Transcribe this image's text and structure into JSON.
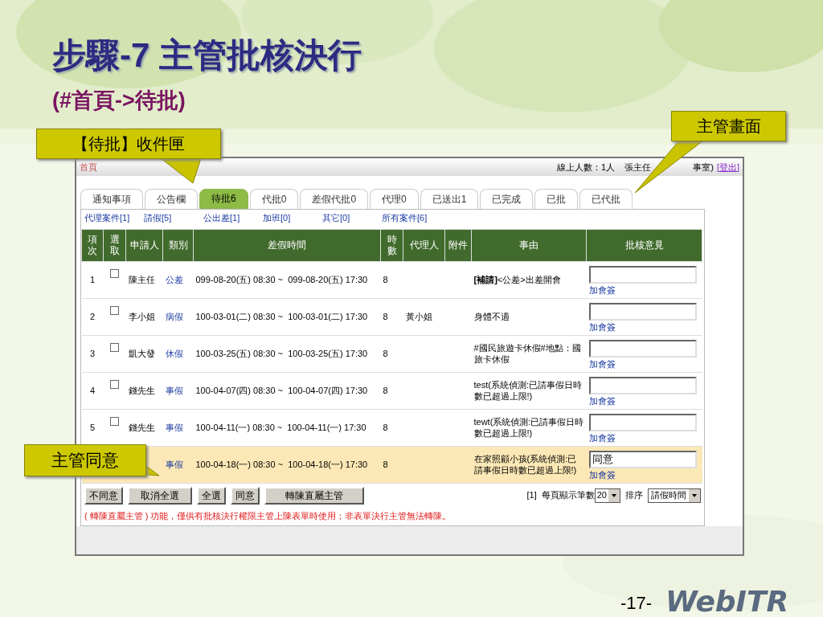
{
  "slide": {
    "title": "步驟-7  主管批核決行",
    "subtitle": "(#首頁->待批)",
    "page_number": "-17-",
    "logo": "WebITR",
    "callouts": [
      {
        "kind": "inbox",
        "text": "【待批】收件匣"
      },
      {
        "kind": "screen",
        "text": "主管畫面"
      },
      {
        "kind": "agree",
        "text": "主管同意"
      }
    ]
  },
  "app": {
    "breadcrumb": "首頁",
    "online": "線上人數：1人",
    "user_visible": [
      "張主任",
      "事室)"
    ],
    "logout": "[登出]",
    "tabs": [
      {
        "label": "通知事項",
        "selected": false
      },
      {
        "label": "公告欄",
        "selected": false
      },
      {
        "label": "待批6",
        "selected": true
      },
      {
        "label": "代批0",
        "selected": false
      },
      {
        "label": "差假代批0",
        "selected": false
      },
      {
        "label": "代理0",
        "selected": false
      },
      {
        "label": "已送出1",
        "selected": false
      },
      {
        "label": "已完成",
        "selected": false
      },
      {
        "label": "已批",
        "selected": false
      },
      {
        "label": "已代批",
        "selected": false
      }
    ],
    "filters": [
      "代理案件[1]",
      "請假[5]",
      "公出差[1]",
      "加班[0]",
      "其它[0]",
      "所有案件[6]"
    ],
    "columns": [
      "項次",
      "選取",
      "申請人",
      "類別",
      "差假時間",
      "時數",
      "代理人",
      "附件",
      "事由",
      "批核意見"
    ],
    "rows": [
      {
        "index": "1",
        "checked": false,
        "applicant": "陳主任",
        "type": "公差",
        "period": "099-08-20(五) 08:30 ~  099-08-20(五) 17:30",
        "hours": "8",
        "reason": "**[補請]**<公差>出差開會",
        "cosign": "加會簽",
        "highlighted": false
      },
      {
        "index": "2",
        "checked": false,
        "applicant": "李小姐",
        "type": "病假",
        "period": "100-03-01(二) 08:30 ~  100-03-01(二) 17:30",
        "hours": "8",
        "agent": "黃小姐",
        "reason": "身體不適",
        "cosign": "加會簽",
        "highlighted": false
      },
      {
        "index": "3",
        "checked": false,
        "applicant": "凱大發",
        "type": "休假",
        "period": "100-03-25(五) 08:30 ~  100-03-25(五) 17:30",
        "hours": "8",
        "reason": "#國民旅遊卡休假#地點：國旅卡休假",
        "cosign": "加會簽",
        "highlighted": false
      },
      {
        "index": "4",
        "checked": false,
        "applicant": "錢先生",
        "type": "事假",
        "period": "100-04-07(四) 08:30 ~  100-04-07(四) 17:30",
        "hours": "8",
        "reason": "test(系統偵測:已請事假日時數已超過上限!)",
        "cosign": "加會簽",
        "highlighted": false
      },
      {
        "index": "5",
        "checked": false,
        "applicant": "錢先生",
        "type": "事假",
        "period": "100-04-11(一) 08:30 ~  100-04-11(一) 17:30",
        "hours": "8",
        "reason": "tewt(系統偵測:已請事假日時數已超過上限!)",
        "cosign": "加會簽",
        "highlighted": false
      },
      {
        "type": "事假",
        "period": "100-04-18(一) 08:30 ~  100-04-18(一) 17:30",
        "hours": "8",
        "reason": "在家照顧小孩(系統偵測:已請事假日時數已超過上限!)",
        "opinion": "同意",
        "cosign": "加會簽",
        "highlighted": true
      }
    ],
    "buttons": [
      "不同意",
      "取消全選",
      "全選",
      "同意",
      "轉陳直屬主管"
    ],
    "pager": "[1]",
    "per_page_label": "每頁顯示筆數",
    "per_page": "20",
    "sort_label": "排序",
    "sort": "請假時間",
    "note": "( 轉陳直屬主管 ) 功能，僅供有批核決行權限主管上陳表單時使用；非表單決行主管無法轉陳。"
  }
}
